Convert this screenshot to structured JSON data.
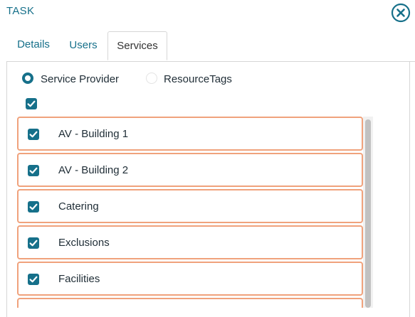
{
  "dialog": {
    "title": "TASK",
    "close_icon": "close-circle-icon"
  },
  "tabs": [
    {
      "label": "Details",
      "active": false
    },
    {
      "label": "Users",
      "active": false
    },
    {
      "label": "Services",
      "active": true
    }
  ],
  "filter": {
    "options": [
      {
        "label": "Service Provider",
        "selected": true
      },
      {
        "label": "ResourceTags",
        "selected": false
      }
    ]
  },
  "select_all": {
    "checked": true
  },
  "services": [
    {
      "label": "AV - Building 1",
      "checked": true
    },
    {
      "label": "AV - Building 2",
      "checked": true
    },
    {
      "label": "Catering",
      "checked": true
    },
    {
      "label": "Exclusions",
      "checked": true
    },
    {
      "label": "Facilities",
      "checked": true
    }
  ],
  "colors": {
    "accent": "#16708a",
    "item_border": "#f0a27c",
    "tab_border": "#d6d6d6"
  }
}
